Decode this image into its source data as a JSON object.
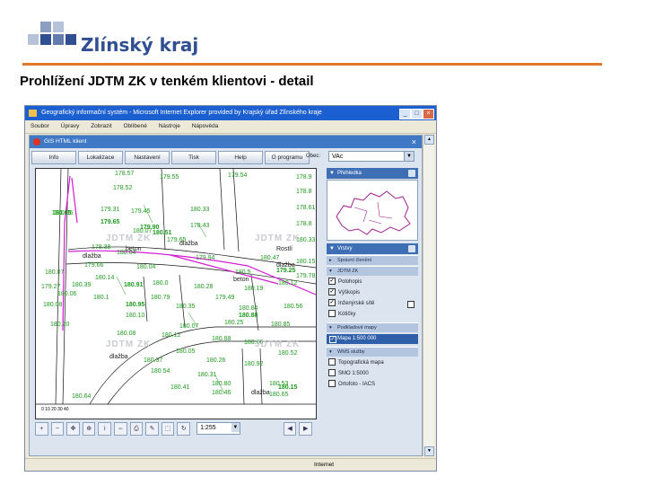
{
  "brand": {
    "name": "Zlínský kraj",
    "accent": "#e0782a",
    "logo_color": "#2f4f91"
  },
  "slide_title": "Prohlížení JDTM ZK v tenkém klientovi - detail",
  "browser": {
    "title": "Geografický informační systém - Microsoft Internet Explorer provided by Krajský úřad Zlínského kraje",
    "menu": [
      "Soubor",
      "Úpravy",
      "Zobrazit",
      "Oblíbené",
      "Nástroje",
      "Nápověda"
    ],
    "status_zone": "Internet"
  },
  "gis": {
    "header": "GIS HTML klient",
    "close": "×",
    "toolbar": [
      "Info",
      "Lokalizace",
      "Nastavení",
      "Tisk",
      "Help",
      "O programu"
    ],
    "obec_label": "Obec:",
    "obec_value": "VAc",
    "scale_value": "1:255",
    "scalebar_text": "0 10 20 30 40",
    "map": {
      "labels_green": [
        "178.57",
        "179.55",
        "179.54",
        "178.9",
        "178.8",
        "178.52",
        "178.61",
        "180.05",
        "179.31",
        "179.45",
        "180.33",
        "178.8",
        "178.43",
        "180.07",
        "179.65",
        "180.33",
        "178.38",
        "180.04",
        "179.94",
        "180.47",
        "180.15",
        "179.66",
        "180.04",
        "180.5",
        "179.78",
        "180.07",
        "180.14",
        "179.27",
        "180.39",
        "180.0",
        "180.28",
        "180.19",
        "180.12",
        "180.06",
        "180.1",
        "180.79",
        "179.49",
        "180.08",
        "180.35",
        "180.84",
        "180.56",
        "180.10",
        "180.07",
        "180.25",
        "180.85",
        "180.20",
        "180.08",
        "180.12",
        "180.88",
        "180.60",
        "180.05",
        "180.37",
        "180.26",
        "180.92",
        "180.54",
        "180.31",
        "180.52",
        "180.80",
        "180.53",
        "180.46",
        "180.65",
        "180.64",
        "180.41"
      ],
      "labels_bold": [
        "180.05",
        "179.65",
        "179.90",
        "180.51",
        "180.91",
        "180.88",
        "180.95",
        "179.25",
        "180.15"
      ],
      "labels_black": [
        "dlažba",
        "dlažba",
        "dlažba",
        "dlažba",
        "dlažba",
        "Rostlí",
        "beton",
        "beton"
      ],
      "watermarks": [
        "JDTM ZK",
        "JDTM ZK",
        "JDTM ZK",
        "JDTM ZK"
      ]
    },
    "right_panel": {
      "overview_title": "Přehledka",
      "layers_title": "Vrstvy",
      "section_spravni": "Správní členění",
      "section_jdtm": "JDTM ZK",
      "layers_jdtm": [
        {
          "label": "Polohopis",
          "checked": true
        },
        {
          "label": "Výškopis",
          "checked": true
        },
        {
          "label": "Inženýrské sítě",
          "checked": true
        },
        {
          "label": "Kótičky",
          "checked": false
        }
      ],
      "section_podkladove": "Podkladové mapy",
      "mapa_500": {
        "label": "Mapa 1:500 000",
        "checked": true
      },
      "section_wms": "WMS služby",
      "layers_wms": [
        {
          "label": "Topografická mapa",
          "checked": false
        },
        {
          "label": "SMO 1:5000",
          "checked": false
        },
        {
          "label": "Ortofoto - IACS",
          "checked": false
        }
      ]
    }
  }
}
